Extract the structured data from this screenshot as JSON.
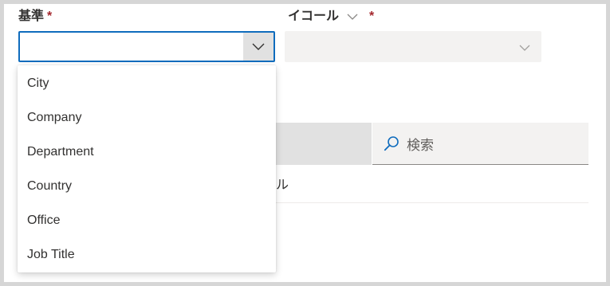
{
  "basis_field": {
    "label": "基準",
    "required_mark": "*",
    "value": "",
    "icon": "chevron-down-icon",
    "options": [
      "City",
      "Company",
      "Department",
      "Country",
      "Office",
      "Job Title"
    ]
  },
  "operator_field": {
    "label": "イコール",
    "required_mark": "*",
    "value": "",
    "icon": "chevron-down-icon",
    "disabled": true
  },
  "search": {
    "placeholder": "検索",
    "icon": "search-icon"
  },
  "table": {
    "visible_cell_fragment": "ル"
  },
  "colors": {
    "accent": "#0f6cbd",
    "required": "#a4262c"
  }
}
